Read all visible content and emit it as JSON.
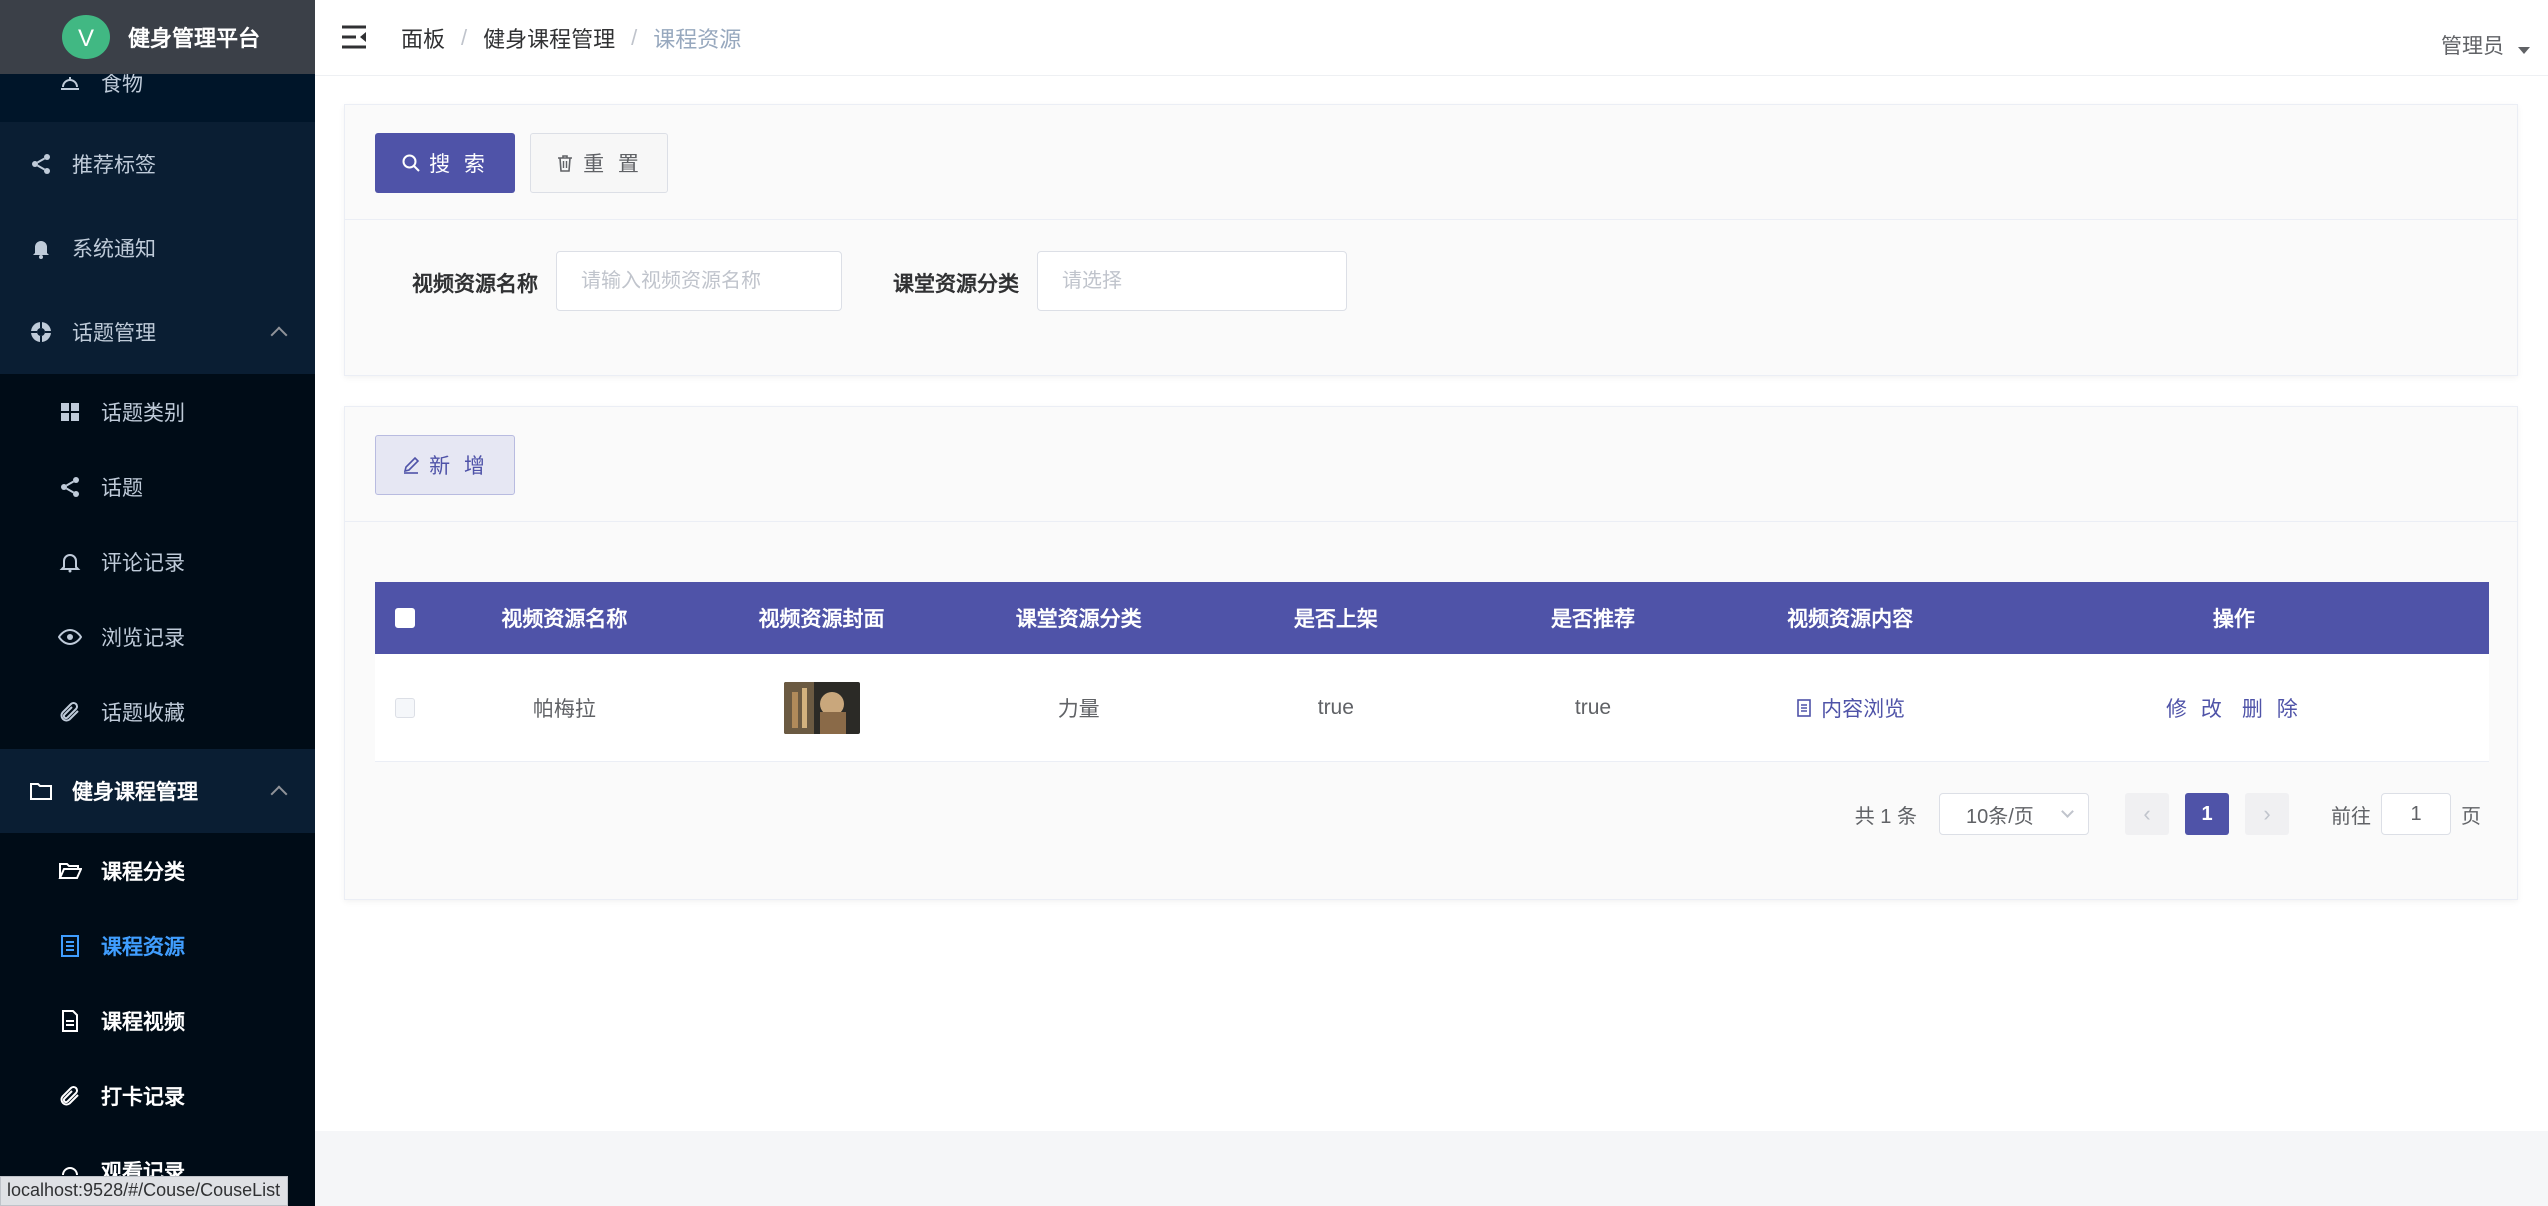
{
  "brand": {
    "title": "健身管理平台",
    "logo_letter": "V"
  },
  "sidebar": {
    "items": [
      {
        "label": "食物",
        "icon": "dish-icon"
      },
      {
        "label": "推荐标签",
        "icon": "share-icon"
      },
      {
        "label": "系统通知",
        "icon": "bell-icon"
      },
      {
        "label": "话题管理",
        "icon": "help-circle-icon"
      },
      {
        "label": "话题类别",
        "icon": "grid-icon"
      },
      {
        "label": "话题",
        "icon": "share-icon"
      },
      {
        "label": "评论记录",
        "icon": "bell-outline-icon"
      },
      {
        "label": "浏览记录",
        "icon": "eye-icon"
      },
      {
        "label": "话题收藏",
        "icon": "paperclip-icon"
      },
      {
        "label": "健身课程管理",
        "icon": "folder-icon"
      },
      {
        "label": "课程分类",
        "icon": "folder-open-icon"
      },
      {
        "label": "课程资源",
        "icon": "document-icon"
      },
      {
        "label": "课程视频",
        "icon": "file-icon"
      },
      {
        "label": "打卡记录",
        "icon": "paperclip-icon"
      },
      {
        "label": "观看记录",
        "icon": "dish-icon"
      }
    ]
  },
  "header": {
    "breadcrumb": [
      "面板",
      "健身课程管理",
      "课程资源"
    ],
    "user": "管理员"
  },
  "search": {
    "search_label": "搜 索",
    "reset_label": "重 置",
    "name_label": "视频资源名称",
    "name_placeholder": "请输入视频资源名称",
    "category_label": "课堂资源分类",
    "category_placeholder": "请选择"
  },
  "actions": {
    "add_label": "新 增"
  },
  "table": {
    "columns": [
      "视频资源名称",
      "视频资源封面",
      "课堂资源分类",
      "是否上架",
      "是否推荐",
      "视频资源内容",
      "操作"
    ],
    "rows": [
      {
        "name": "帕梅拉",
        "category": "力量",
        "on_shelf": "true",
        "recommended": "true",
        "content_link": "内容浏览",
        "edit_label": "修 改",
        "delete_label": "删 除"
      }
    ]
  },
  "pagination": {
    "total": "共 1 条",
    "page_size": "10条/页",
    "current_page": "1",
    "goto_prefix": "前往",
    "goto_value": "1",
    "goto_suffix": "页"
  },
  "status_bar": {
    "url": "localhost:9528/#/Couse/CouseList"
  },
  "colors": {
    "sidebar_bg": "#001529",
    "primary": "#4f53a8",
    "active_menu": "#409eff",
    "brand_bar": "#3b4048"
  }
}
